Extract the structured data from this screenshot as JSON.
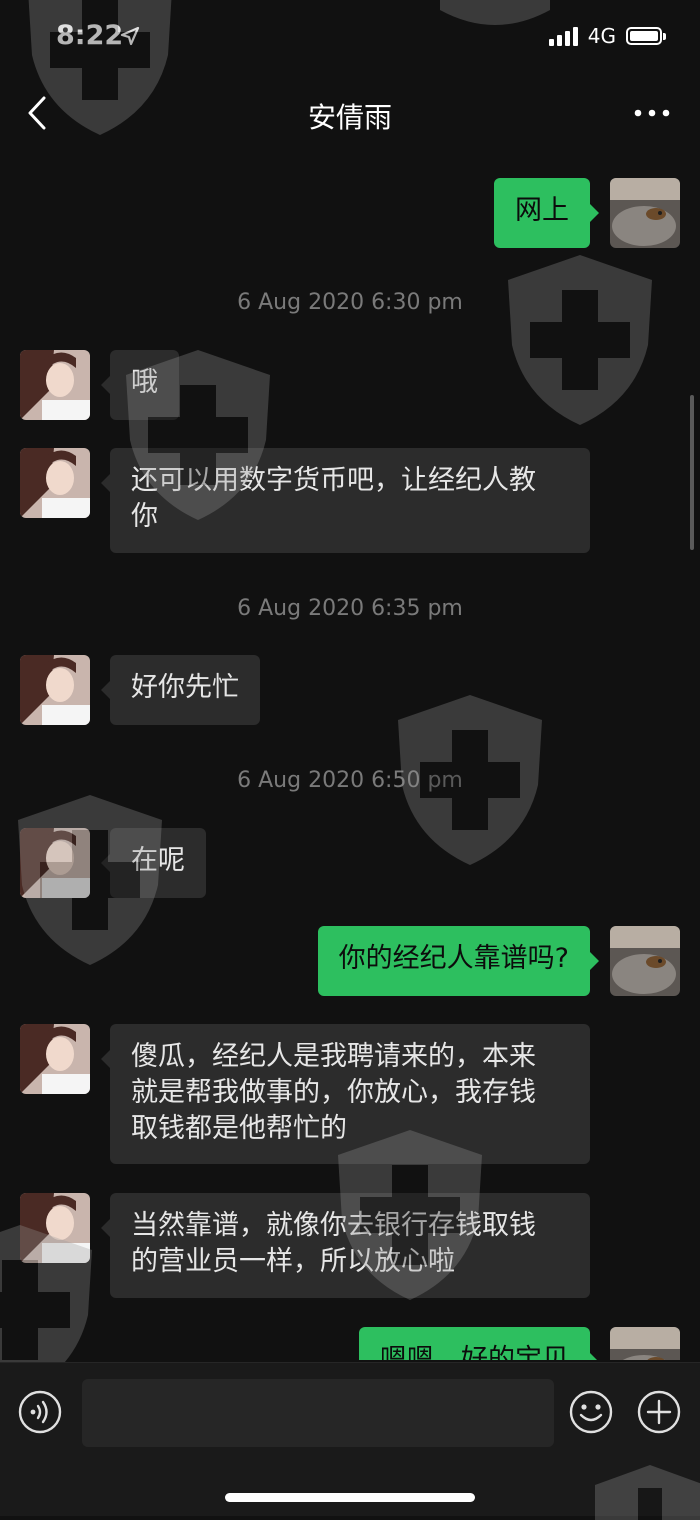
{
  "status_bar": {
    "time": "8:22",
    "network": "4G"
  },
  "nav": {
    "title": "安倩雨"
  },
  "messages": {
    "m1": "网上",
    "ts1": "6 Aug 2020 6:30 pm",
    "m2": "哦",
    "m3_line1": "还可以用数字货币吧，让经纪人教",
    "m3_line2": "你",
    "ts2": "6 Aug 2020 6:35 pm",
    "m4": "好你先忙",
    "ts3": "6 Aug 2020 6:50 pm",
    "m5": "在呢",
    "m6": "你的经纪人靠谱吗?",
    "m7_line1": "傻瓜，经纪人是我聘请来的，本来",
    "m7_line2": "就是帮我做事的，你放心，我存钱",
    "m7_line3": "取钱都是他帮忙的",
    "m8_line1": "当然靠谱，就像你去银行存钱取钱",
    "m8_line2": "的营业员一样，所以放心啦",
    "m9": "嗯嗯，好的宝贝"
  },
  "colors": {
    "background": "#111111",
    "incoming_bubble": "#2c2c2c",
    "outgoing_bubble": "#2dbf5f",
    "timestamp": "#7a7a7a"
  },
  "icons": {
    "back": "chevron-left-icon",
    "more": "more-dots-icon",
    "voice": "voice-icon",
    "emoji": "emoji-icon",
    "plus": "plus-icon"
  }
}
